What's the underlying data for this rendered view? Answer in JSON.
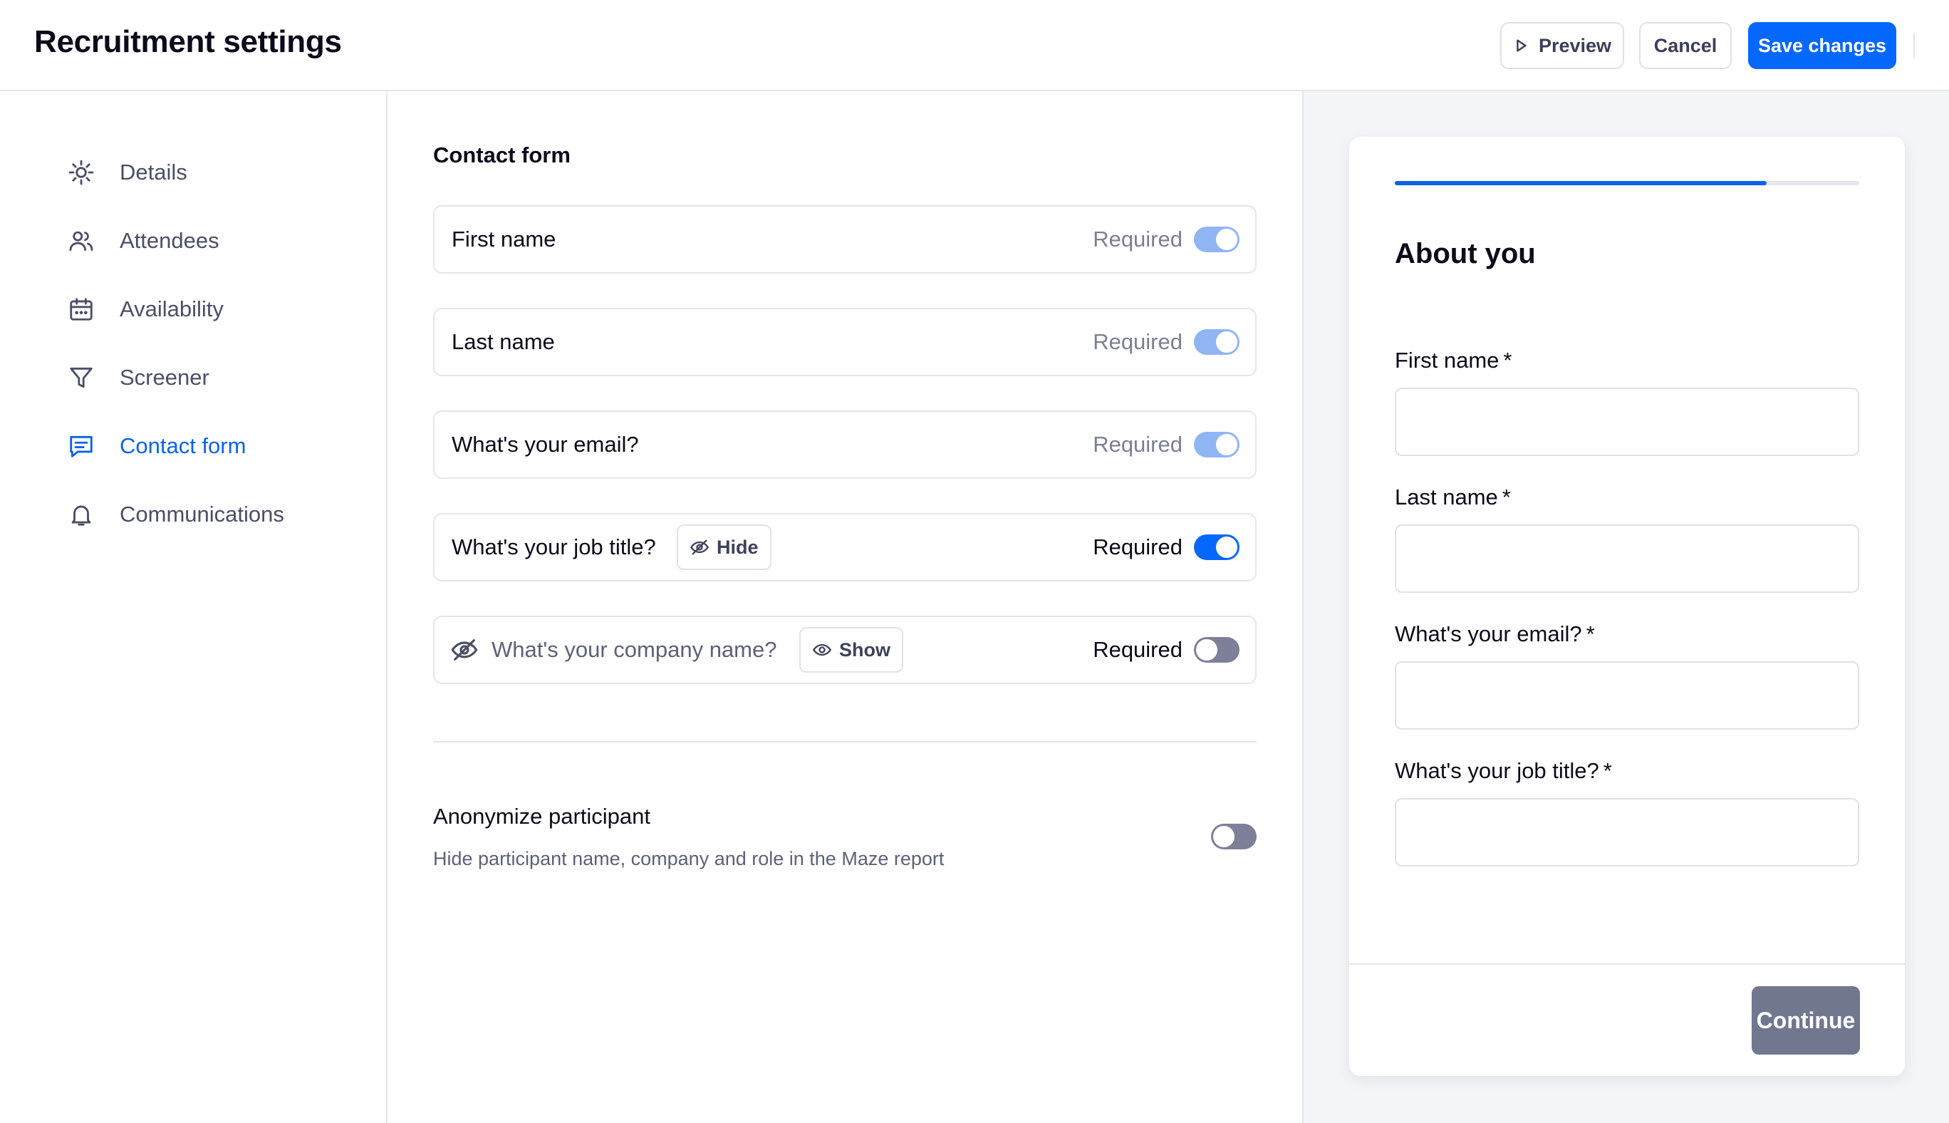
{
  "header": {
    "title": "Recruitment settings",
    "preview_label": "Preview",
    "cancel_label": "Cancel",
    "save_label": "Save changes"
  },
  "sidebar": {
    "items": [
      {
        "label": "Details",
        "icon": "gear-icon"
      },
      {
        "label": "Attendees",
        "icon": "users-icon"
      },
      {
        "label": "Availability",
        "icon": "calendar-icon"
      },
      {
        "label": "Screener",
        "icon": "filter-icon"
      },
      {
        "label": "Contact form",
        "icon": "message-icon",
        "active": true
      },
      {
        "label": "Communications",
        "icon": "bell-icon"
      }
    ]
  },
  "main": {
    "section_title": "Contact form",
    "fields": [
      {
        "label": "First name",
        "required_label": "Required",
        "required": true,
        "locked": true
      },
      {
        "label": "Last name",
        "required_label": "Required",
        "required": true,
        "locked": true
      },
      {
        "label": "What's your email?",
        "required_label": "Required",
        "required": true,
        "locked": true
      },
      {
        "label": "What's your job title?",
        "required_label": "Required",
        "required": true,
        "chip": "Hide",
        "chip_icon": "eye-off-icon"
      },
      {
        "label": "What's your company name?",
        "required_label": "Required",
        "required": false,
        "hidden": true,
        "chip": "Show",
        "chip_icon": "eye-icon"
      }
    ],
    "anonymize": {
      "title": "Anonymize participant",
      "description": "Hide participant name, company and role in the Maze report",
      "enabled": false
    }
  },
  "preview": {
    "progress": 0.8,
    "title": "About you",
    "form": [
      {
        "label": "First name",
        "required_mark": "*",
        "value": ""
      },
      {
        "label": "Last name",
        "required_mark": "*",
        "value": ""
      },
      {
        "label": "What's your email?",
        "required_mark": "*",
        "value": ""
      },
      {
        "label": "What's your job title?",
        "required_mark": "*",
        "value": ""
      }
    ],
    "continue_label": "Continue"
  },
  "colors": {
    "accent": "#0568fd",
    "active_nav": "#0a63e6",
    "toggle_locked": "#8fb5f5",
    "toggle_off": "#7d8098",
    "continue_button": "#727790"
  }
}
